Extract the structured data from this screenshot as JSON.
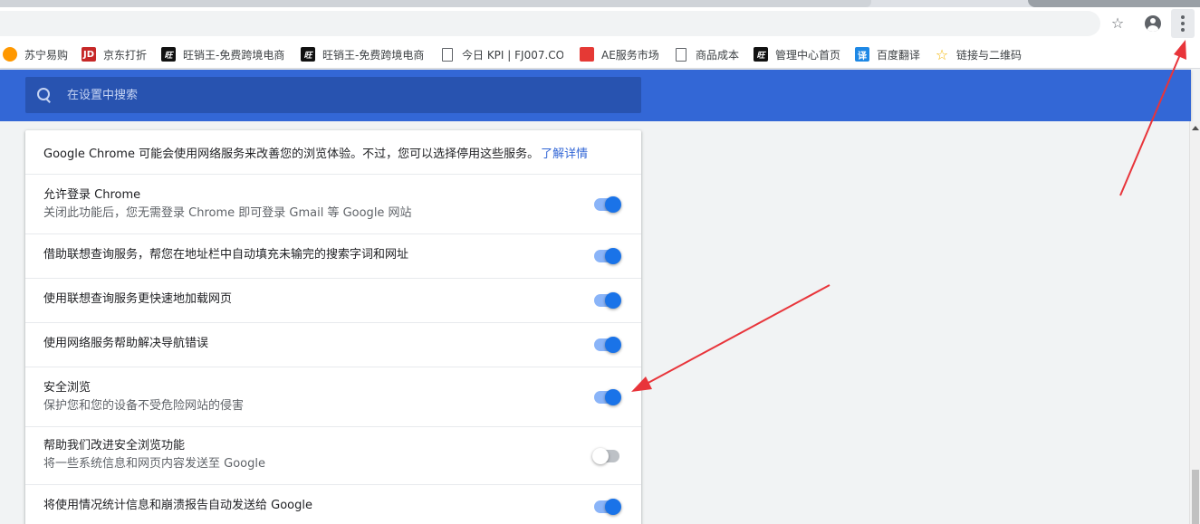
{
  "toolbar": {
    "star_icon": "star-outline-icon",
    "account_icon": "account-circle-icon",
    "menu_icon": "three-dot-menu-icon"
  },
  "bookmarks": [
    {
      "icon": "suning",
      "glyph": "",
      "label": "苏宁易购"
    },
    {
      "icon": "jd",
      "glyph": "JD",
      "label": "京东打折"
    },
    {
      "icon": "wx",
      "glyph": "旺",
      "label": "旺销王-免费跨境电商"
    },
    {
      "icon": "wx",
      "glyph": "旺",
      "label": "旺销王-免费跨境电商"
    },
    {
      "icon": "file",
      "glyph": "",
      "label": "今日 KPI | FJ007.COM"
    },
    {
      "icon": "ae",
      "glyph": "",
      "label": "AE服务市场"
    },
    {
      "icon": "file",
      "glyph": "",
      "label": "商品成本"
    },
    {
      "icon": "wx",
      "glyph": "旺",
      "label": "管理中心首页"
    },
    {
      "icon": "fanyi",
      "glyph": "译",
      "label": "百度翻译"
    },
    {
      "icon": "starb",
      "glyph": "☆",
      "label": "链接与二维码"
    }
  ],
  "search": {
    "placeholder": "在设置中搜索"
  },
  "intro": {
    "text": "Google Chrome 可能会使用网络服务来改善您的浏览体验。不过，您可以选择停用这些服务。",
    "link": "了解详情"
  },
  "settings": [
    {
      "label": "允许登录 Chrome",
      "sub": "关闭此功能后，您无需登录 Chrome 即可登录 Gmail 等 Google 网站",
      "on": true
    },
    {
      "label": "借助联想查询服务，帮您在地址栏中自动填充未输完的搜索字词和网址",
      "sub": "",
      "on": true
    },
    {
      "label": "使用联想查询服务更快速地加载网页",
      "sub": "",
      "on": true
    },
    {
      "label": "使用网络服务帮助解决导航错误",
      "sub": "",
      "on": true
    },
    {
      "label": "安全浏览",
      "sub": "保护您和您的设备不受危险网站的侵害",
      "on": true
    },
    {
      "label": "帮助我们改进安全浏览功能",
      "sub": "将一些系统信息和网页内容发送至 Google",
      "on": false
    },
    {
      "label": "将使用情况统计信息和崩溃报告自动发送给 Google",
      "sub": "",
      "on": true
    }
  ],
  "colors": {
    "header_blue": "#3367d6",
    "toggle_on": "#1a73e8",
    "annotation_red": "#e8343a"
  }
}
